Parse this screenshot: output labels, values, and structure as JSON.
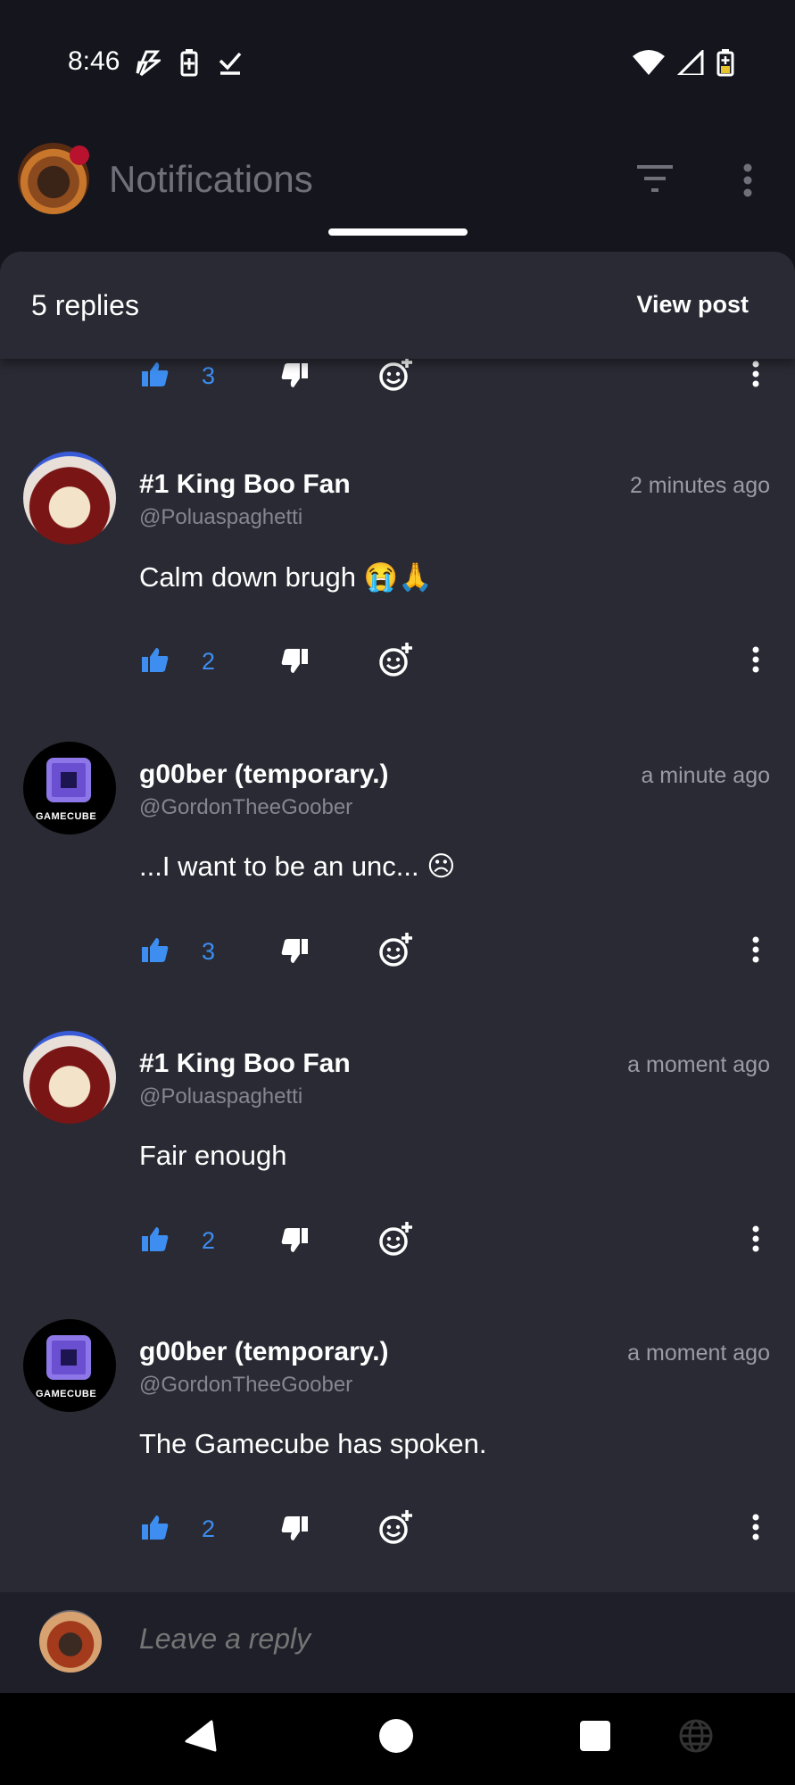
{
  "status_bar": {
    "time": "8:46"
  },
  "app_bar": {
    "title": "Notifications"
  },
  "sheet": {
    "replies_count": "5 replies",
    "view_post_label": "View post"
  },
  "partial_comment": {
    "like_count": "3"
  },
  "comments": [
    {
      "name": "#1 King Boo Fan",
      "handle": "@Poluaspaghetti",
      "time": "2 minutes ago",
      "text": "Calm down brugh 😭🙏",
      "like_count": "2",
      "avatar": "boo"
    },
    {
      "name": "g00ber (temporary.)",
      "handle": "@GordonTheeGoober",
      "time": "a minute ago",
      "text": "...I want to be an unc... ☹",
      "like_count": "3",
      "avatar": "gamecube",
      "avatar_label": "GAMECUBE"
    },
    {
      "name": "#1 King Boo Fan",
      "handle": "@Poluaspaghetti",
      "time": "a moment ago",
      "text": "Fair enough",
      "like_count": "2",
      "avatar": "boo"
    },
    {
      "name": "g00ber (temporary.)",
      "handle": "@GordonTheeGoober",
      "time": "a moment ago",
      "text": "The Gamecube has spoken.",
      "like_count": "2",
      "avatar": "gamecube",
      "avatar_label": "GAMECUBE"
    }
  ],
  "reply_bar": {
    "placeholder": "Leave a reply"
  },
  "colors": {
    "background": "#14151d",
    "sheet": "#292a33",
    "accent_blue": "#3d8ef0",
    "muted_text": "#85868f"
  },
  "icons": [
    "thumbs-up-icon",
    "thumbs-down-icon",
    "add-reaction-icon",
    "more-vertical-icon",
    "filter-icon",
    "wifi-icon",
    "signal-icon",
    "battery-icon"
  ]
}
